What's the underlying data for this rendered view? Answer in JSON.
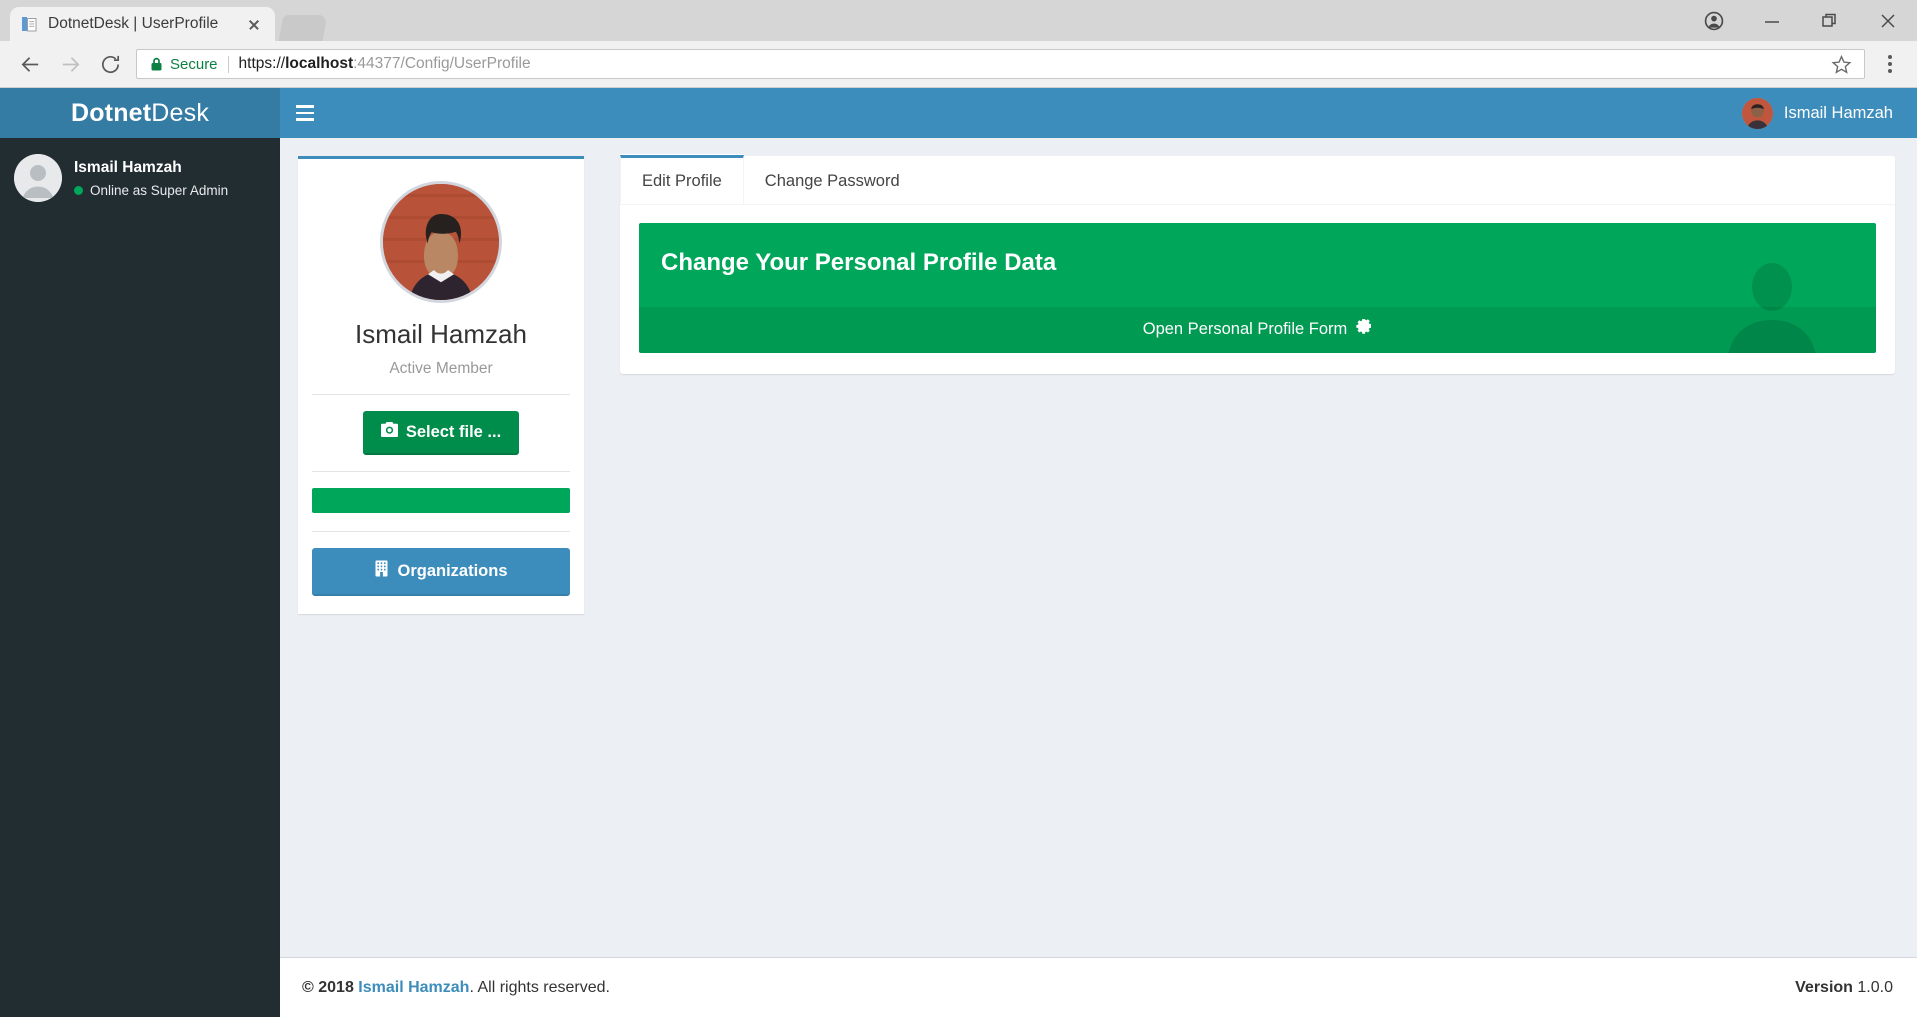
{
  "browser": {
    "tab_title": "DotnetDesk | UserProfile",
    "tab_favicon_icon": "document-pages-icon",
    "close_tab_icon": "close-icon",
    "new_tab_icon": "new-tab-icon",
    "back_icon": "back-arrow-icon",
    "forward_icon": "forward-arrow-icon",
    "reload_icon": "reload-icon",
    "lock_icon": "lock-icon",
    "secure_label": "Secure",
    "url_scheme": "https://",
    "url_host": "localhost",
    "url_rest": ":44377/Config/UserProfile",
    "url_full": "https://localhost:44377/Config/UserProfile",
    "bookmark_icon": "star-icon",
    "menu_icon": "three-dots-menu-icon",
    "profile_icon": "user-account-icon",
    "minimize_icon": "minimize-icon",
    "maximize_icon": "restore-window-icon",
    "close_window_icon": "close-window-icon"
  },
  "sidebar": {
    "logo_bold": "Dotnet",
    "logo_light": "Desk",
    "avatar_icon": "default-user-avatar-icon",
    "user_name": "Ismail Hamzah",
    "user_status": "Online as Super Admin",
    "status_dot_color": "#00a65a"
  },
  "navbar": {
    "hamburger_icon": "hamburger-menu-icon",
    "user_name": "Ismail Hamzah",
    "avatar_icon": "user-photo-avatar",
    "background_color": "#3c8dbc"
  },
  "profile_box": {
    "avatar_icon": "user-profile-photo",
    "username": "Ismail Hamzah",
    "description": "Active Member",
    "select_file_label": "Select file ...",
    "select_file_icon": "camera-icon",
    "progress_color": "#00a65a",
    "organizations_label": "Organizations",
    "organizations_icon": "building-icon"
  },
  "tabs": {
    "items": [
      {
        "label": "Edit Profile",
        "active": true
      },
      {
        "label": "Change Password",
        "active": false
      }
    ]
  },
  "widget": {
    "title": "Change Your Personal Profile Data",
    "footer_link": "Open Personal Profile Form",
    "footer_icon": "gear-icon",
    "watermark_icon": "person-silhouette-icon",
    "background_color": "#00a65a"
  },
  "footer": {
    "copyright_symbol": "©",
    "year": "2018",
    "author": "Ismail Hamzah",
    "rights_text": ". All rights reserved.",
    "version_label": "Version",
    "version_number": "1.0.0"
  }
}
